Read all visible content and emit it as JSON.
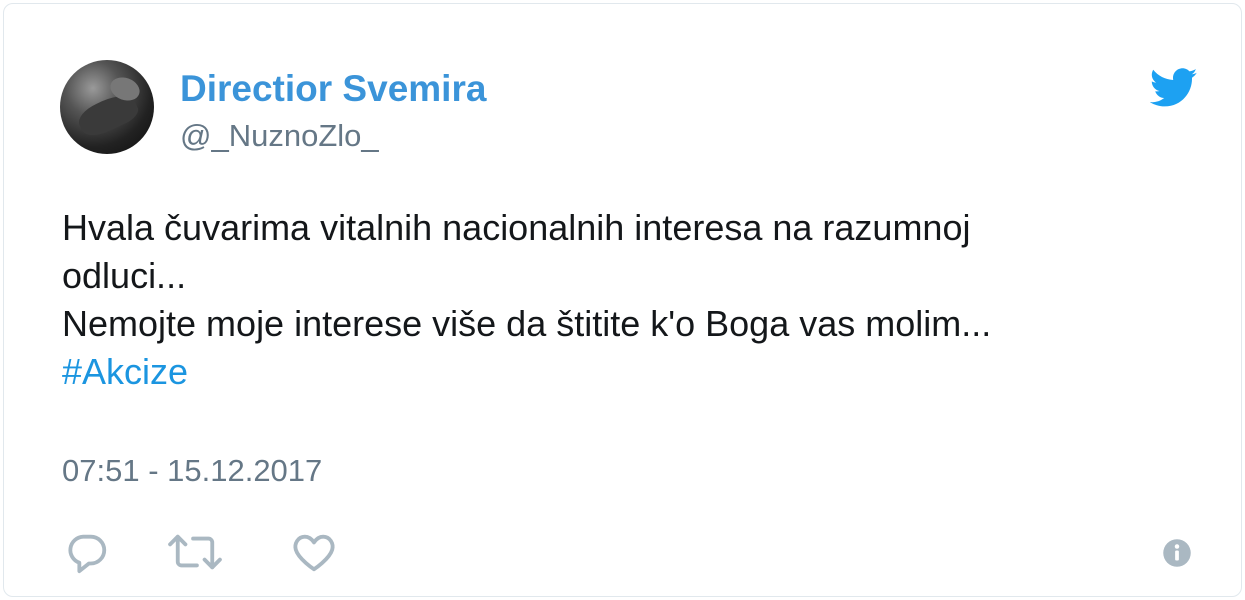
{
  "tweet": {
    "author_name": "Directior Svemira",
    "handle": "@_NuznoZlo_",
    "text_lines": [
      "Hvala čuvarima vitalnih nacionalnih interesa na razumnoj",
      "odluci...",
      "Nemojte moje interese više da štitite k'o Boga vas molim..."
    ],
    "hashtag": "#Akcize",
    "timestamp": "07:51 - 15.12.2017"
  },
  "colors": {
    "name": "#3b94d9",
    "hashtag": "#1b95e0",
    "meta": "#657786",
    "text": "#14171a",
    "icon": "#aab8c2",
    "twitter_bird": "#1da1f2"
  },
  "icons": {
    "brand": "twitter-bird-icon",
    "reply": "reply-icon",
    "retweet": "retweet-icon",
    "like": "like-icon",
    "info": "info-icon"
  }
}
